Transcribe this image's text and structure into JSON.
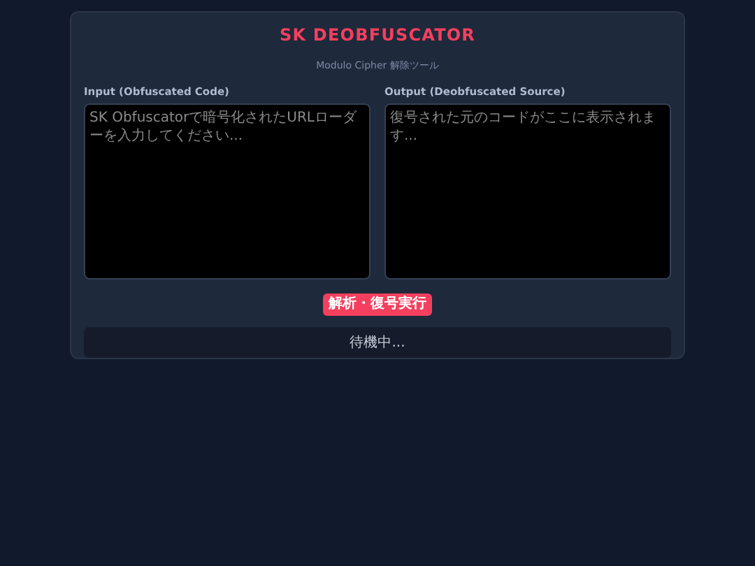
{
  "header": {
    "title": "SK DEOBFUSCATOR",
    "subtitle": "Modulo Cipher 解除ツール"
  },
  "panels": [
    {
      "label": "Input (Obfuscated Code)",
      "placeholder": "SK Obfuscatorで暗号化されたURLローダーを入力してください..."
    },
    {
      "label": "Output (Deobfuscated Source)",
      "placeholder": "復号された元のコードがここに表示されます..."
    }
  ],
  "action_button": "解析・復号実行",
  "status": "待機中..."
}
